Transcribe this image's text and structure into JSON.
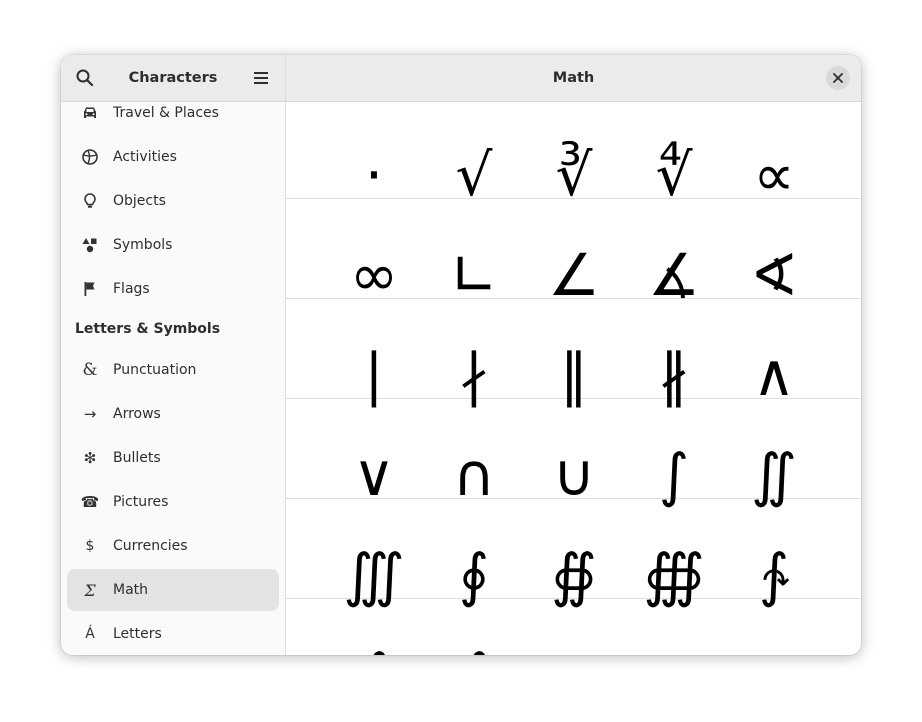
{
  "window": {
    "sidebar_title": "Characters",
    "main_title": "Math"
  },
  "sidebar": {
    "items": [
      {
        "label": "Travel & Places",
        "icon": "car-icon"
      },
      {
        "label": "Activities",
        "icon": "ball-icon"
      },
      {
        "label": "Objects",
        "icon": "lightbulb-icon"
      },
      {
        "label": "Symbols",
        "icon": "shapes-icon"
      },
      {
        "label": "Flags",
        "icon": "flag-icon"
      }
    ],
    "section_header": "Letters & Symbols",
    "letter_items": [
      {
        "label": "Punctuation",
        "glyph": "&"
      },
      {
        "label": "Arrows",
        "glyph": "→"
      },
      {
        "label": "Bullets",
        "glyph": "❇"
      },
      {
        "label": "Pictures",
        "glyph": "☎"
      },
      {
        "label": "Currencies",
        "glyph": "$"
      },
      {
        "label": "Math",
        "glyph": "Σ",
        "selected": true
      },
      {
        "label": "Letters",
        "glyph": "Á"
      }
    ]
  },
  "characters": [
    [
      "·",
      "√",
      "∛",
      "∜",
      "∝"
    ],
    [
      "∞",
      "∟",
      "∠",
      "∡",
      "∢"
    ],
    [
      "∣",
      "∤",
      "∥",
      "∦",
      "∧"
    ],
    [
      "∨",
      "∩",
      "∪",
      "∫",
      "∬"
    ],
    [
      "∭",
      "∮",
      "∯",
      "∰",
      "∱"
    ],
    [
      "∲",
      "∳"
    ]
  ]
}
